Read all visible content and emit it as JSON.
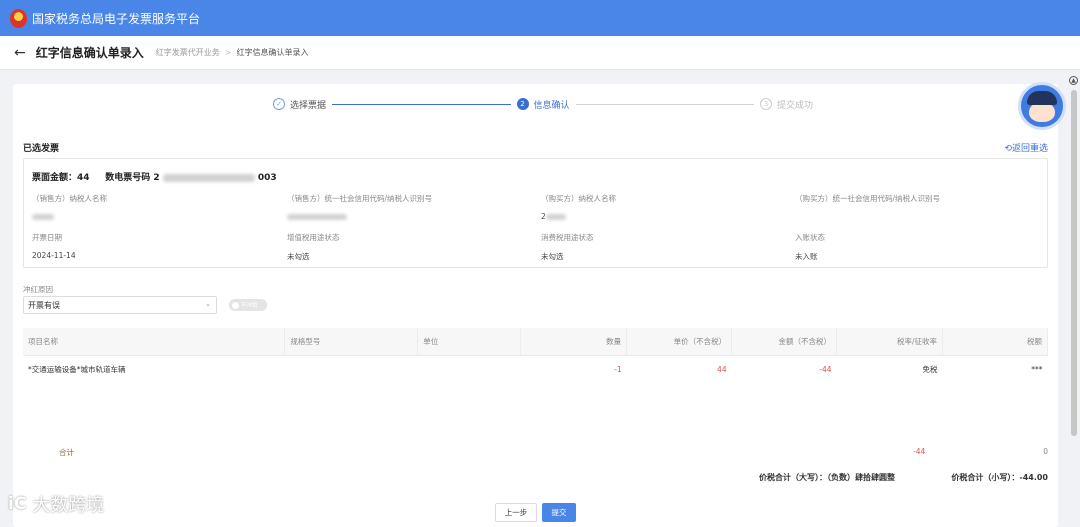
{
  "app": {
    "title": "国家税务总局电子发票服务平台"
  },
  "header": {
    "page_title": "红字信息确认单录入",
    "breadcrumbs": [
      "红字发票代开业务",
      "红字信息确认单录入"
    ],
    "breadcrumb_sep": ">"
  },
  "steps": [
    {
      "label": "选择票据",
      "state": "done",
      "icon": "✓"
    },
    {
      "label": "信息确认",
      "state": "active",
      "icon": "2"
    },
    {
      "label": "提交成功",
      "state": "pending",
      "icon": "3"
    }
  ],
  "selected": {
    "section_title": "已选发票",
    "return_link": "⟲返回重选",
    "amount_label": "票面金额：44",
    "invoice_no_label": "数电票号码 2",
    "invoice_no_tail": "003"
  },
  "fields": {
    "seller_name_label": "（销售方）纳税人名称",
    "seller_id_label": "（销售方）统一社会信用代码/纳税人识别号",
    "buyer_name_label": "（购买方）纳税人名称",
    "buyer_id_label": "（购买方）统一社会信用代码/纳税人识别号",
    "buyer_name_value": "2",
    "date_label": "开票日期",
    "date_value": "2024-11-14",
    "vat_label": "增值税用途状态",
    "vat_value": "未勾选",
    "consume_label": "消费税用途状态",
    "consume_value": "未勾选",
    "entry_label": "入账状态",
    "entry_value": "未入账"
  },
  "reason": {
    "label": "冲红原因",
    "value": "开票有误",
    "toggle_text": "不冲销"
  },
  "table": {
    "headers": [
      "项目名称",
      "规格型号",
      "单位",
      "数量",
      "单价（不含税）",
      "金额（不含税）",
      "税率/征收率",
      "税额"
    ],
    "rows": [
      [
        "*交通运输设备*城市轨道车辆",
        "",
        "",
        "-1",
        "44",
        "-44",
        "免税",
        "***"
      ]
    ],
    "sum_label": "合计",
    "sum_amount": "-44",
    "sum_tax": "0"
  },
  "totals": {
    "upper_label": "价税合计（大写）：（负数）肆拾肆圆整",
    "lower_label": "价税合计（小写）：-44.00"
  },
  "buttons": {
    "prev": "上一步",
    "submit": "提交"
  },
  "watermark": {
    "logo": "iC",
    "text": "大数跨境"
  },
  "colors": {
    "primary": "#4a86e8",
    "negative": "#d9534f"
  },
  "icons": {
    "back": "arrow-left-icon",
    "mascot": "tax-mascot-icon"
  }
}
